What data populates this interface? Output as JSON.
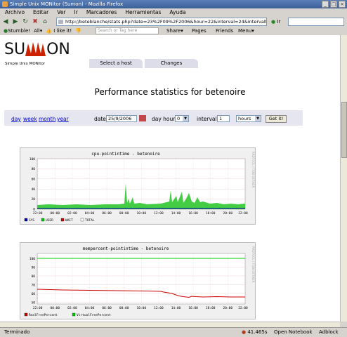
{
  "window": {
    "title": "Simple Unix MONitor (Sumon) - Mozilla Firefox"
  },
  "menu": [
    "Archivo",
    "Editar",
    "Ver",
    "Ir",
    "Marcadores",
    "Herramientas",
    "Ayuda"
  ],
  "nav": {
    "url": "http://beteblanche/stats.php?date=23%2F09%2F2006&hour=22&interval=24&intervaltype=h",
    "go_label": "Ir"
  },
  "stumble": {
    "stumble_label": "Stumble!",
    "all_label": "All",
    "ilike_label": "I like it!",
    "tag_placeholder": "Search or Tag here",
    "share_label": "Share",
    "pages_label": "Pages",
    "friends_label": "Friends",
    "menu_label": "Menu"
  },
  "header": {
    "logo_left": "SU",
    "logo_right": "ON",
    "tagline": "Simple Unix MONitor"
  },
  "tabs": [
    "Select a host",
    "Changes"
  ],
  "page": {
    "title": "Performance statistics for betenoire"
  },
  "controls": {
    "links": [
      "day",
      "week",
      "month",
      "year"
    ],
    "date_label": "date",
    "date_value": "25/9/2006",
    "dayhour_label": "day hour",
    "dayhour_value": "0",
    "interval_label": "interval",
    "interval_value": "1",
    "intervaltype_value": "hours",
    "submit_label": "Get it!"
  },
  "graphs": {
    "cpu": {
      "title": "cpu-pointintime - betenoire",
      "side_text": "RRDTOOL / TOBI OETIKER",
      "y_ticks": [
        "100",
        "80",
        "60",
        "40",
        "20",
        "0"
      ],
      "x_ticks": [
        "22:00",
        "00:00",
        "02:00",
        "04:00",
        "06:00",
        "08:00",
        "10:00",
        "12:00",
        "14:00",
        "16:00",
        "18:00",
        "20:00",
        "22:00"
      ],
      "legend": [
        {
          "name": "SYS",
          "color": "#0000aa"
        },
        {
          "name": "USER",
          "color": "#00cc00"
        },
        {
          "name": "WAIT",
          "color": "#cc0000"
        },
        {
          "name": "TOTAL",
          "color": "#ffffff"
        }
      ]
    },
    "mem": {
      "title": "mempercent-pointintime - betenoire",
      "side_text": "RRDTOOL / TOBI OETIKER",
      "y_ticks": [
        "100",
        "90",
        "80",
        "70",
        "60",
        "50"
      ],
      "x_ticks": [
        "22:00",
        "00:00",
        "02:00",
        "04:00",
        "06:00",
        "08:00",
        "10:00",
        "12:00",
        "14:00",
        "16:00",
        "18:00",
        "20:00",
        "22:00"
      ],
      "legend": [
        {
          "name": "RealFreePercent",
          "color": "#cc0000"
        },
        {
          "name": "VirtualFreePercent",
          "color": "#00cc00"
        }
      ]
    }
  },
  "status": {
    "text": "Terminado",
    "time": "41.465s",
    "notebook": "Open Notebook",
    "adblock": "Adblock"
  }
}
